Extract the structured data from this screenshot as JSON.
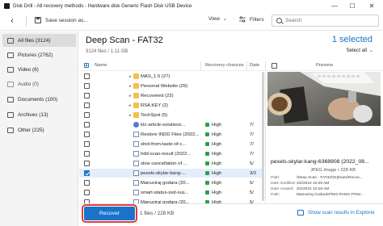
{
  "window": {
    "title": "Disk Drill - All recovery methods - Hardware disk Generic Flash Disk USB Device",
    "minimize": "—",
    "maximize": "☐",
    "close": "✕"
  },
  "toolbar": {
    "back_icon": "‹",
    "save_label": "Save session as...",
    "view_label": "View",
    "view_chevron": "⌄",
    "filters_label": "Filters",
    "search_placeholder": "Search"
  },
  "sidebar": {
    "items": [
      {
        "label": "All files (3124)"
      },
      {
        "label": "Pictures (2762)"
      },
      {
        "label": "Video (6)"
      },
      {
        "label": "Audio (0)"
      },
      {
        "label": "Documents (100)"
      },
      {
        "label": "Archives (13)"
      },
      {
        "label": "Other (225)"
      }
    ]
  },
  "main": {
    "scan_title": "Deep Scan - FAT32",
    "scan_subtitle": "3124 files / 1.11 GB",
    "selected_count": "1 selected",
    "select_all": "Select all",
    "select_all_chevron": "⌄"
  },
  "table": {
    "headers": {
      "name": "Name",
      "recovery": "Recovery chances",
      "date": "Date"
    },
    "rows": [
      {
        "type": "folder",
        "name": "MAS_1.5 (27)",
        "recovery": "",
        "date": ""
      },
      {
        "type": "folder",
        "name": "Personal Website (29)",
        "recovery": "",
        "date": ""
      },
      {
        "type": "folder",
        "name": "Recovered (22)",
        "recovery": "",
        "date": ""
      },
      {
        "type": "folder",
        "name": "RSA KEY (2)",
        "recovery": "",
        "date": ""
      },
      {
        "type": "folder",
        "name": "TechSpot (5)",
        "recovery": "",
        "date": ""
      },
      {
        "type": "round",
        "name": "ktc-article-solutions...",
        "recovery": "High",
        "date": "7/"
      },
      {
        "type": "file",
        "name": "Restore INDD Files (2022...",
        "recovery": "High",
        "date": "7/"
      },
      {
        "type": "file",
        "name": "shot-from-taste-of-c...",
        "recovery": "High",
        "date": "7/"
      },
      {
        "type": "file",
        "name": "hdd-scan-result (2022...",
        "recovery": "High",
        "date": "7/"
      },
      {
        "type": "file",
        "name": "slow cancellation of ...",
        "recovery": "High",
        "date": "5/"
      },
      {
        "type": "file",
        "name": "pexels-skylar-kang-...",
        "recovery": "High",
        "date": "3/2"
      },
      {
        "type": "file",
        "name": "Manuviraj godara (20...",
        "recovery": "High",
        "date": "5/"
      },
      {
        "type": "file",
        "name": "smart-status-ssd-sus...",
        "recovery": "High",
        "date": "5/"
      },
      {
        "type": "file",
        "name": "Manuviraj godara (20...",
        "recovery": "High",
        "date": "5/"
      }
    ]
  },
  "preview": {
    "header": "Preview",
    "filename": "pexels-skylar-kang-6368908 (2022_08...",
    "filetype": "JPEG Image • 228 KB",
    "meta": [
      {
        "key": "Path:",
        "value": "\\Deep Scan - FAT32\\Orphans\\Recov..."
      },
      {
        "key": "Date modified:",
        "value": "3/2/2022 10:28 AM"
      },
      {
        "key": "Date created:",
        "value": "3/2/2022 10:28 AM"
      },
      {
        "key": "Path:",
        "value": "Manuviraj Godara\\PING-PANG-POW..."
      }
    ]
  },
  "footer": {
    "recover_label": "Recover",
    "info": "1 files / 228 KB",
    "show_results": "Show scan results in Explorer"
  },
  "colors": {
    "accent": "#1a73c8",
    "high_recovery": "#2e9e4f",
    "recover_outline": "#e23b3b"
  }
}
